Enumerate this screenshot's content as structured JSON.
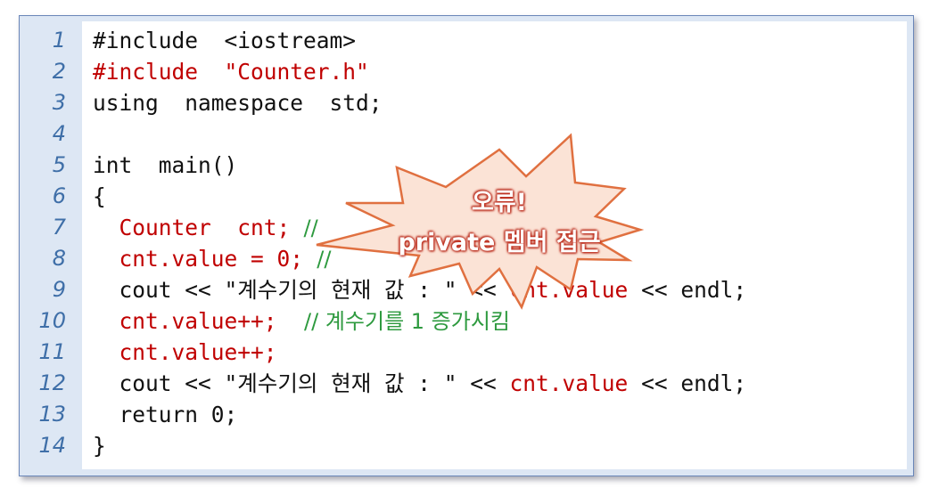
{
  "lines": [
    {
      "no": "1",
      "text": "#include  <iostream>",
      "color": "k"
    },
    {
      "no": "2",
      "text": "#include  \"Counter.h\"",
      "color": "r"
    },
    {
      "no": "3",
      "text": "using  namespace  std;",
      "color": "k"
    },
    {
      "no": "4",
      "text": "",
      "color": "k"
    },
    {
      "no": "5",
      "text": "int  main()",
      "color": "k"
    },
    {
      "no": "6",
      "text": "{",
      "color": "k"
    },
    {
      "no": "7",
      "code": "  Counter  cnt;",
      "code_color": "r",
      "comment": "  //",
      "comment_color": "g"
    },
    {
      "no": "8",
      "code": "  cnt.value = 0;",
      "code_color": "r",
      "comment": "  //                     로 시킴",
      "comment_color": "g"
    },
    {
      "no": "9",
      "segments": [
        {
          "t": "  cout << \"계수기의 현재 값 : \" << ",
          "c": "k"
        },
        {
          "t": "cnt.value",
          "c": "r"
        },
        {
          "t": " << endl;",
          "c": "k"
        }
      ]
    },
    {
      "no": "10",
      "code": "  cnt.value++;",
      "code_color": "r",
      "comment": "    // 계수기를 1 증가시킴",
      "comment_color": "g"
    },
    {
      "no": "11",
      "text": "  cnt.value++;",
      "color": "r"
    },
    {
      "no": "12",
      "segments": [
        {
          "t": "  cout << \"계수기의 현재 값 : \" << ",
          "c": "k"
        },
        {
          "t": "cnt.value",
          "c": "r"
        },
        {
          "t": " << endl;",
          "c": "k"
        }
      ]
    },
    {
      "no": "13",
      "text": "  return 0;",
      "color": "k"
    },
    {
      "no": "14",
      "text": "}",
      "color": "k"
    }
  ],
  "callout": {
    "line1": "오류!",
    "line2": "private  멤버 접근"
  },
  "colors": {
    "keyword": "#111111",
    "red": "#c00000",
    "comment": "#2e9a3f",
    "line_number": "#3f6fa8",
    "gutter_bg": "#dde7f4",
    "burst_fill": "#fbe3d6",
    "burst_stroke": "#e07040"
  }
}
